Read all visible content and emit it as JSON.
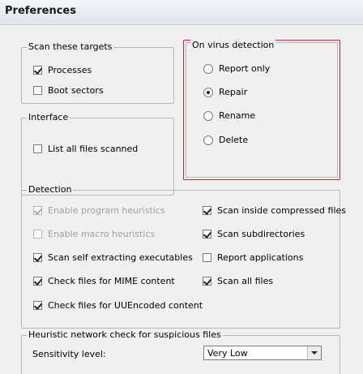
{
  "window": {
    "title": "Preferences"
  },
  "scan_targets": {
    "legend": "Scan these targets",
    "options": [
      {
        "label": "Processes",
        "checked": true
      },
      {
        "label": "Boot sectors",
        "checked": false
      }
    ]
  },
  "interface": {
    "legend": "Interface",
    "options": [
      {
        "label": "List all files scanned",
        "checked": false
      }
    ]
  },
  "on_virus_detection": {
    "legend": "On virus detection",
    "selected": "Repair",
    "options": [
      {
        "label": "Report only"
      },
      {
        "label": "Repair"
      },
      {
        "label": "Rename"
      },
      {
        "label": "Delete"
      }
    ]
  },
  "detection": {
    "legend": "Detection",
    "left_options": [
      {
        "label": "Enable program heuristics",
        "checked": true,
        "disabled": true
      },
      {
        "label": "Enable macro heuristics",
        "checked": false,
        "disabled": true
      },
      {
        "label": "Scan self extracting executables",
        "checked": true,
        "disabled": false
      },
      {
        "label": "Check files for MIME content",
        "checked": true,
        "disabled": false
      },
      {
        "label": "Check files for UUEncoded content",
        "checked": true,
        "disabled": false
      }
    ],
    "right_options": [
      {
        "label": "Scan inside compressed files",
        "checked": true
      },
      {
        "label": "Scan subdirectories",
        "checked": true
      },
      {
        "label": "Report applications",
        "checked": false
      },
      {
        "label": "Scan all files",
        "checked": true
      }
    ]
  },
  "heuristic": {
    "legend": "Heuristic network check for suspicious files",
    "sensitivity_label": "Sensitivity level:",
    "sensitivity_value": "Very Low"
  },
  "colors": {
    "highlight_border": "#d0202a",
    "panel_bg": "#f0f0f0"
  }
}
